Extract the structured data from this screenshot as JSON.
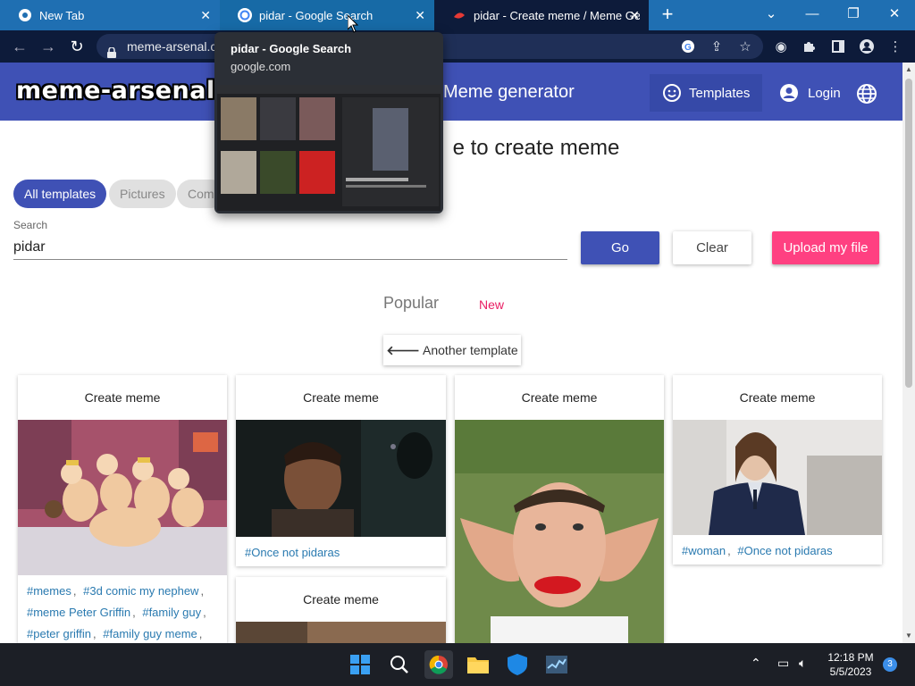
{
  "browser": {
    "tabs": [
      {
        "title": "New Tab",
        "close": "✕"
      },
      {
        "title": "pidar - Google Search",
        "close": "✕"
      },
      {
        "title": "pidar - Create meme / Meme Ge",
        "close": "✕"
      }
    ],
    "new_tab": "+",
    "window_controls": [
      "⌄",
      "—",
      "❐",
      "✕"
    ],
    "address": "meme-arsenal.c",
    "nav": {
      "back": "←",
      "forward": "→",
      "reload": "↻"
    }
  },
  "hover_preview": {
    "title": "pidar - Google Search",
    "domain": "google.com"
  },
  "site": {
    "logo": "meme-arsenal",
    "title": "Meme generator",
    "templates_label": "Templates",
    "login_label": "Login",
    "heading_fragment": "e to create meme"
  },
  "filters": [
    "All templates",
    "Pictures",
    "Com"
  ],
  "search": {
    "label": "Search",
    "value": "pidar"
  },
  "buttons": {
    "go": "Go",
    "clear": "Clear",
    "upload": "Upload my file"
  },
  "sort_tabs": {
    "popular": "Popular",
    "new": "New"
  },
  "another_template": "Another template",
  "cards": [
    {
      "title": "Create meme",
      "tags": [
        "#memes",
        "#3d comic my nephew",
        "#meme Peter Griffin",
        "#family guy",
        "#peter griffin",
        "#family guy meme"
      ]
    },
    {
      "title": "Create meme",
      "tags": [
        "#Once not pidaras"
      ]
    },
    {
      "title": "Create meme",
      "tags": []
    },
    {
      "title": "Create meme",
      "tags": [
        "#woman",
        "#Once not pidaras"
      ]
    },
    {
      "title": "Create meme",
      "tags": []
    }
  ],
  "taskbar": {
    "apps": [
      "windows-start",
      "search",
      "chrome",
      "file-explorer",
      "windows-security",
      "task-manager"
    ],
    "time": "12:18 PM",
    "date": "5/5/2023",
    "notifications": "3"
  },
  "colors": {
    "brand": "#3f51b5",
    "accent": "#ff4081",
    "tag_link": "#2a7ab0"
  }
}
